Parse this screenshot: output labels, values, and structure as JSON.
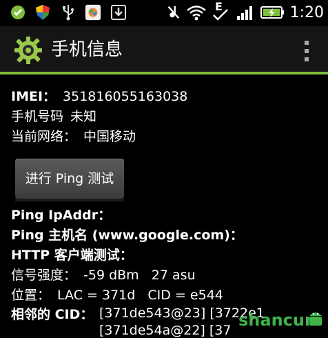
{
  "status_bar": {
    "time": "1:20",
    "icons": [
      "check-circle-icon",
      "shield-icon",
      "usb-icon",
      "photo-app-icon",
      "download-icon",
      "mute-icon",
      "wifi-icon",
      "edge-data-icon",
      "signal-icon",
      "battery-charging-icon"
    ],
    "edge_letter": "E"
  },
  "action_bar": {
    "title": "手机信息",
    "accent_color": "#7fbf3a"
  },
  "info": {
    "imei_label": "IMEI：",
    "imei_value": "351816055163038",
    "phone_label": "手机号码",
    "phone_value": "未知",
    "network_label": "当前网络：",
    "network_value": "中国移动"
  },
  "ping_button_label": "进行 Ping 测试",
  "details": {
    "ping_ip_label": "Ping IpAddr：",
    "ping_host_label": "Ping 主机名 (www.google.com)：",
    "http_label": "HTTP 客户端测试：",
    "signal_label": "信号强度：",
    "signal_value": "-59 dBm   27 asu",
    "location_label": "位置：",
    "location_value": "LAC = 371d   CID = e544",
    "neighbor_label": "相邻的 CID：",
    "neighbor_line1": "[371de543@23] [3722e1",
    "neighbor_line2": "[371de54a@22] [37"
  },
  "watermark": {
    "text": "shancun"
  }
}
